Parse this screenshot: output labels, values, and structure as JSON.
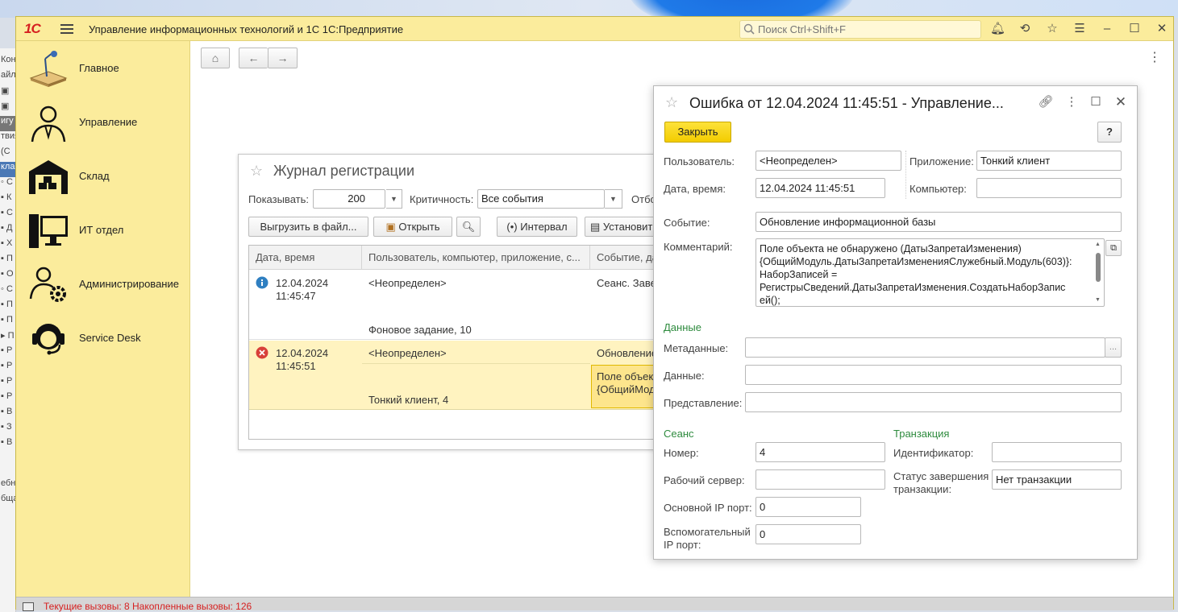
{
  "app": {
    "logo": "1С",
    "title": "Управление информационных технологий и 1С 1С:Предприятие",
    "search_placeholder": "Поиск Ctrl+Shift+F"
  },
  "sidebar": {
    "items": [
      {
        "label": "Главное",
        "icon": "desk-lamp-icon"
      },
      {
        "label": "Управление",
        "icon": "manager-icon"
      },
      {
        "label": "Склад",
        "icon": "warehouse-icon"
      },
      {
        "label": "ИТ отдел",
        "icon": "computer-icon"
      },
      {
        "label": "Администрирование",
        "icon": "admin-gear-icon"
      },
      {
        "label": "Service Desk",
        "icon": "headset-icon"
      }
    ]
  },
  "status": {
    "text": "Текущие вызовы: 8   Накопленные вызовы: 126"
  },
  "journal": {
    "title": "Журнал регистрации",
    "show_label": "Показывать:",
    "show_value": "200",
    "criticality_label": "Критичность:",
    "criticality_value": "Все события",
    "extra_label": "Отбо",
    "buttons": {
      "export": "Выгрузить в файл...",
      "open": "Открыть",
      "interval": "Интервал",
      "set": "Установить"
    },
    "columns": [
      "Дата, время",
      "Пользователь, компьютер, приложение, с...",
      "Событие, да"
    ],
    "rows": [
      {
        "level": "info",
        "date": "12.04.2024",
        "time": "11:45:47",
        "user": "<Неопределен>",
        "app": "Фоновое задание, 10",
        "event": "Сеанс. Заве",
        "comment1": "",
        "comment2": ""
      },
      {
        "level": "error",
        "date": "12.04.2024",
        "time": "11:45:51",
        "user": "<Неопределен>",
        "app": "Тонкий клиент, 4",
        "event": "Обновление",
        "comment1": "Поле объект",
        "comment2": "{ОбщийМод"
      }
    ]
  },
  "dialog": {
    "title": "Ошибка от 12.04.2024 11:45:51 - Управление...",
    "close_button": "Закрыть",
    "help": "?",
    "user_label": "Пользователь:",
    "user_value": "<Неопределен>",
    "app_label": "Приложение:",
    "app_value": "Тонкий клиент",
    "datetime_label": "Дата, время:",
    "datetime_value": "12.04.2024 11:45:51",
    "computer_label": "Компьютер:",
    "computer_value": "",
    "event_label": "Событие:",
    "event_value": "Обновление информационной базы",
    "comment_label": "Комментарий:",
    "comment_lines": [
      "Поле объекта не обнаружено (ДатыЗапретаИзменения)",
      "{ОбщийМодуль.ДатыЗапретаИзмененияСлужебный.Модуль(603)}:",
      "НаборЗаписей =",
      "РегистрыСведений.ДатыЗапретаИзменения.СоздатьНаборЗапис",
      "ей();"
    ],
    "data_section": "Данные",
    "metadata_label": "Метаданные:",
    "metadata_value": "",
    "metadata_btn": "...",
    "data_label": "Данные:",
    "data_value": "",
    "repr_label": "Представление:",
    "repr_value": "",
    "session_section": "Сеанс",
    "number_label": "Номер:",
    "number_value": "4",
    "server_label": "Рабочий сервер:",
    "server_value": "",
    "main_port_label": "Основной IP порт:",
    "main_port_value": "0",
    "aux_port_label_1": "Вспомогательный",
    "aux_port_label_2": "IP порт:",
    "aux_port_value": "0",
    "tx_section": "Транзакция",
    "tx_id_label": "Идентификатор:",
    "tx_id_value": "",
    "tx_status_label_1": "Статус завершения",
    "tx_status_label_2": "транзакции:",
    "tx_status_value": "Нет транзакции"
  },
  "colors": {
    "accent_yellow": "#fbec9c",
    "button_yellow": "#f3cc00",
    "section_green": "#2e8b3e",
    "status_red": "#d62020",
    "selected_row": "#fff3c0"
  }
}
